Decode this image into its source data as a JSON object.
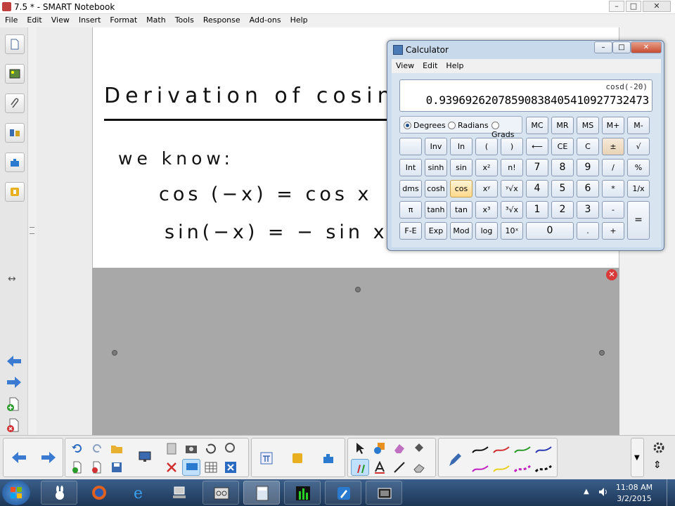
{
  "window": {
    "title": "7.5 * - SMART Notebook",
    "minimize": "–",
    "maximize": "□",
    "close": "✕"
  },
  "menu": [
    "File",
    "Edit",
    "View",
    "Insert",
    "Format",
    "Math",
    "Tools",
    "Response",
    "Add-ons",
    "Help"
  ],
  "page": {
    "heading": "Derivation of cosine",
    "line1": "we know:",
    "line2": "cos (−x) = cos x",
    "line3": "sin(−x) = − sin x"
  },
  "calculator": {
    "title": "Calculator",
    "menu": [
      "View",
      "Edit",
      "Help"
    ],
    "expression": "cosd(-20)",
    "result": "0.93969262078590838405410927732473",
    "modes": [
      {
        "label": "Degrees",
        "selected": true
      },
      {
        "label": "Radians",
        "selected": false
      },
      {
        "label": "Grads",
        "selected": false
      }
    ],
    "row1": [
      "MC",
      "MR",
      "MS",
      "M+",
      "M-"
    ],
    "row2": [
      "",
      "Inv",
      "In",
      "(",
      ")",
      "⟵",
      "CE",
      "C",
      "±",
      "√"
    ],
    "row3": [
      "Int",
      "sinh",
      "sin",
      "x²",
      "n!",
      "7",
      "8",
      "9",
      "/",
      "%"
    ],
    "row4": [
      "dms",
      "cosh",
      "cos",
      "xʸ",
      "ʸ√x",
      "4",
      "5",
      "6",
      "*",
      "1/x"
    ],
    "row5": [
      "π",
      "tanh",
      "tan",
      "x³",
      "³√x",
      "1",
      "2",
      "3",
      "-",
      "="
    ],
    "row6": [
      "F-E",
      "Exp",
      "Mod",
      "log",
      "10ˣ",
      "0",
      ".",
      "+"
    ]
  },
  "colors": {
    "accent_key": "#ffd98a",
    "close_red": "#d83a3a",
    "taskbar": "#1c3556"
  },
  "taskbar": {
    "time": "11:08 AM",
    "date": "3/2/2015"
  }
}
